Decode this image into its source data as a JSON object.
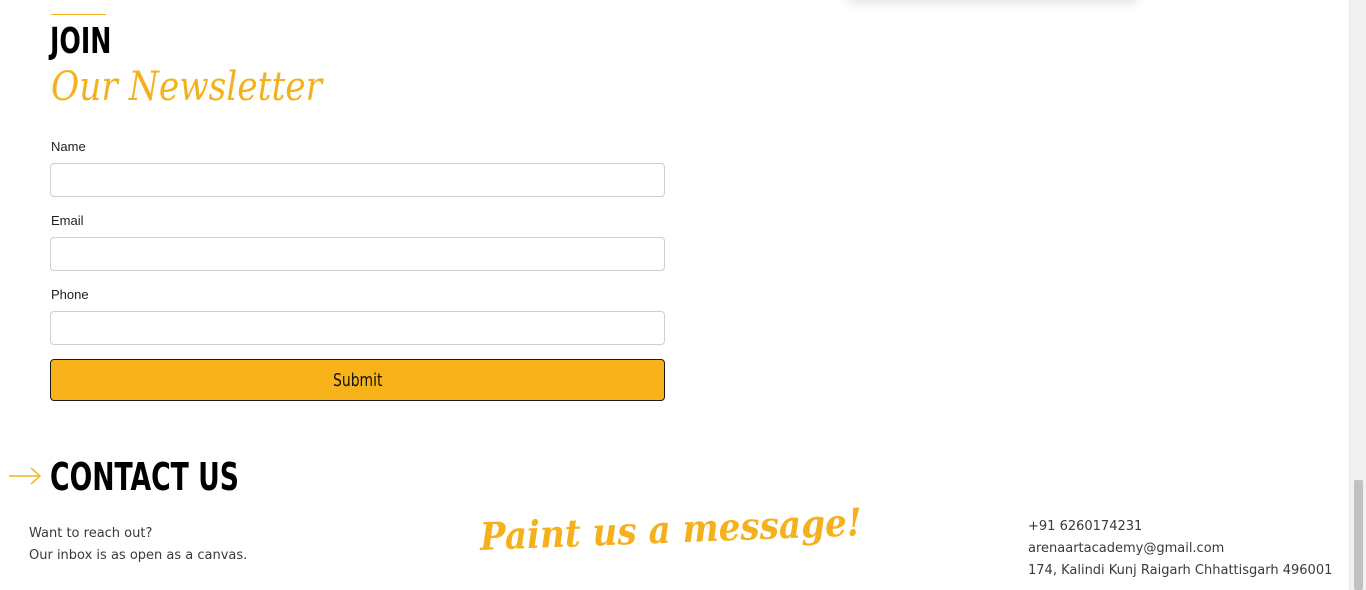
{
  "newsletter": {
    "heading": "JOIN",
    "subheading": "Our Newsletter",
    "fields": {
      "name_label": "Name",
      "name_value": "",
      "email_label": "Email",
      "email_value": "",
      "phone_label": "Phone",
      "phone_value": ""
    },
    "submit_label": "Submit"
  },
  "contact": {
    "heading": "CONTACT US",
    "intro_line1": "Want to reach out?",
    "intro_line2": "Our inbox is as open as a canvas.",
    "tagline": "Paint us a message!",
    "phone": "+91 6260174231",
    "email": "arenaartacademy@gmail.com",
    "address": "174, Kalindi Kunj Raigarh Chhattisgarh 496001"
  },
  "icons": {
    "arrow": "arrow-right-icon"
  },
  "colors": {
    "accent": "#f5b01d",
    "button": "#f8b31b",
    "heading": "#000000",
    "body_text": "#3a3a3a"
  }
}
